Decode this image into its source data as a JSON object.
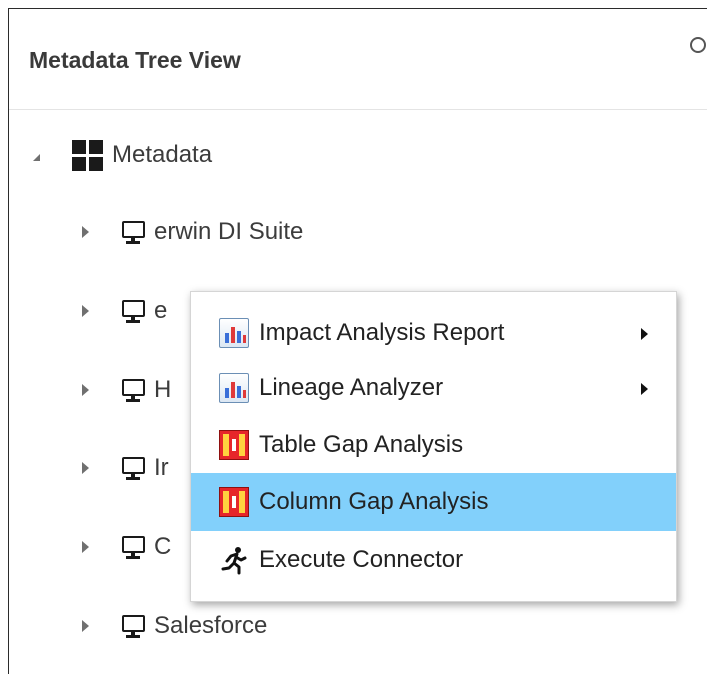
{
  "panel": {
    "title": "Metadata Tree View",
    "header_icon": "refresh-icon"
  },
  "tree": {
    "root": {
      "label": "Metadata",
      "icon": "grid-icon",
      "state": "expanded"
    },
    "items": [
      {
        "label": "erwin DI Suite",
        "icon": "monitor-icon"
      },
      {
        "label": "e",
        "icon": "monitor-icon"
      },
      {
        "label": "H",
        "icon": "monitor-icon"
      },
      {
        "label": "Ir",
        "icon": "monitor-icon"
      },
      {
        "label": "C",
        "icon": "monitor-icon"
      },
      {
        "label": "Salesforce",
        "icon": "monitor-icon"
      }
    ]
  },
  "context_menu": {
    "items": [
      {
        "label": "Impact Analysis Report",
        "icon": "report-chart-icon",
        "has_submenu": true
      },
      {
        "label": "Lineage Analyzer",
        "icon": "report-chart-icon",
        "has_submenu": true
      },
      {
        "label": "Table Gap Analysis",
        "icon": "gap-analysis-icon",
        "has_submenu": false
      },
      {
        "label": "Column Gap Analysis",
        "icon": "gap-analysis-icon",
        "has_submenu": false,
        "highlighted": true
      },
      {
        "label": "Execute Connector",
        "icon": "run-icon",
        "has_submenu": false
      }
    ]
  },
  "colors": {
    "highlight": "#82d0fb",
    "gap_icon_red": "#e6262a",
    "gap_icon_yellow": "#ffd23f"
  }
}
